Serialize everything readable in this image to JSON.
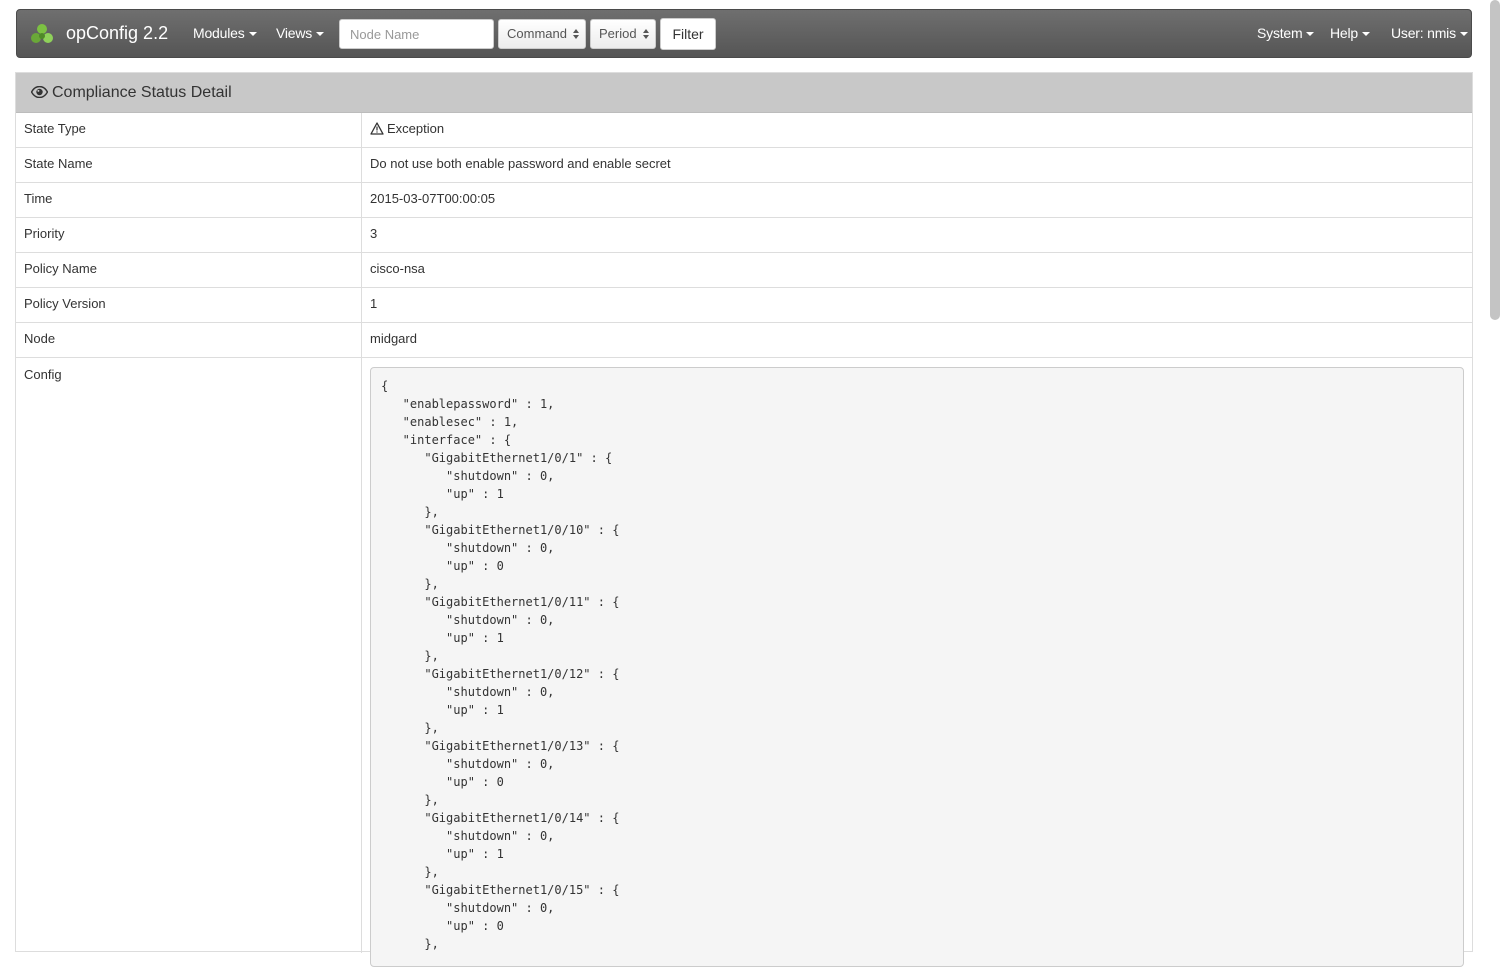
{
  "navbar": {
    "brand": "opConfig 2.2",
    "menus": {
      "modules": "Modules",
      "views": "Views",
      "system": "System",
      "help": "Help",
      "user": "User: nmis"
    },
    "search": {
      "placeholder": "Node Name",
      "value": ""
    },
    "command_select": "Command",
    "period_select": "Period",
    "filter_button": "Filter",
    "colors": {
      "bar": "#5f5f5f",
      "logo": "#7cc142"
    }
  },
  "panel": {
    "title": "Compliance Status Detail",
    "title_icon": "eye-icon",
    "rows": [
      {
        "label": "State Type",
        "value": "Exception",
        "icon": "warning-icon"
      },
      {
        "label": "State Name",
        "value": "Do not use both enable password and enable secret"
      },
      {
        "label": "Time",
        "value": "2015-03-07T00:00:05"
      },
      {
        "label": "Priority",
        "value": "3"
      },
      {
        "label": "Policy Name",
        "value": "cisco-nsa"
      },
      {
        "label": "Policy Version",
        "value": "1"
      },
      {
        "label": "Node",
        "value": "midgard"
      }
    ],
    "config_label": "Config",
    "config_text": "{\n   \"enablepassword\" : 1,\n   \"enablesec\" : 1,\n   \"interface\" : {\n      \"GigabitEthernet1/0/1\" : {\n         \"shutdown\" : 0,\n         \"up\" : 1\n      },\n      \"GigabitEthernet1/0/10\" : {\n         \"shutdown\" : 0,\n         \"up\" : 0\n      },\n      \"GigabitEthernet1/0/11\" : {\n         \"shutdown\" : 0,\n         \"up\" : 1\n      },\n      \"GigabitEthernet1/0/12\" : {\n         \"shutdown\" : 0,\n         \"up\" : 1\n      },\n      \"GigabitEthernet1/0/13\" : {\n         \"shutdown\" : 0,\n         \"up\" : 0\n      },\n      \"GigabitEthernet1/0/14\" : {\n         \"shutdown\" : 0,\n         \"up\" : 1\n      },\n      \"GigabitEthernet1/0/15\" : {\n         \"shutdown\" : 0,\n         \"up\" : 0\n      },"
  }
}
